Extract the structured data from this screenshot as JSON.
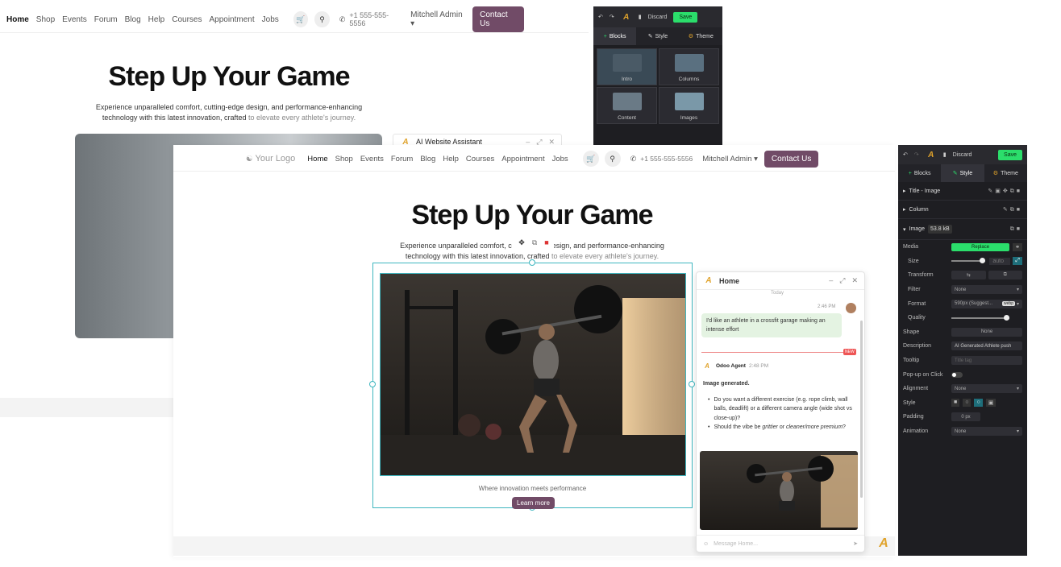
{
  "colors": {
    "brand": "#714b67",
    "save": "#2bde6b",
    "panel": "#1e1e22",
    "teal_selection": "#3fb6bf",
    "ai_accent": "#e0a32b"
  },
  "nav": {
    "logo": "Your Logo",
    "links": [
      "Home",
      "Shop",
      "Events",
      "Forum",
      "Blog",
      "Help",
      "Courses",
      "Appointment",
      "Jobs"
    ],
    "cart_icon": "cart-icon",
    "search_icon": "search-icon",
    "phone": "+1 555-555-5556",
    "user": "Mitchell Admin",
    "contact": "Contact Us"
  },
  "hero": {
    "title": "Step Up Your Game",
    "subtitle_start": "Experience unparalleled comfort, cutting-edge design, and performance-enhancing",
    "subtitle_line2": "technology with this latest innovation, crafted",
    "subtitle_highlight": "to elevate every athlete's journey.",
    "front_sub_a": "Experience unparalleled comfort,",
    "front_sub_a2": "c",
    "front_sub_b": "esign, and performance-enhancing",
    "caption": "Where innovation meets performance",
    "cta": "Learn more"
  },
  "back_assistant": {
    "title": "AI Website Assistant"
  },
  "back_editor": {
    "top": {
      "save": "Save",
      "discard": "Discard"
    },
    "tabs": [
      "Blocks",
      "Style",
      "Theme"
    ],
    "blocks": [
      "Intro",
      "Columns",
      "Content",
      "Images"
    ]
  },
  "editor": {
    "top": {
      "discard": "Discard",
      "save": "Save"
    },
    "tabs": [
      "Blocks",
      "Style",
      "Theme"
    ],
    "sections": {
      "title_image": "Title - Image",
      "column": "Column",
      "image": "Image",
      "image_size": "53.8 kB"
    },
    "options": {
      "media": "Media",
      "media_btn": "Replace",
      "size": "Size",
      "size_val": "auto",
      "transform": "Transform",
      "filter": "Filter",
      "filter_val": "None",
      "format": "Format",
      "format_val": "590px (Suggest...",
      "format_tag": "webp",
      "quality": "Quality",
      "shape": "Shape",
      "shape_val": "None",
      "description": "Description",
      "description_val": "AI Generated Athlete push",
      "tooltip": "Tooltip",
      "tooltip_ph": "Title tag",
      "popup": "Pop-up on Click",
      "alignment": "Alignment",
      "alignment_val": "None",
      "style": "Style",
      "padding": "Padding",
      "padding_val": "0 px",
      "animation": "Animation",
      "animation_val": "None"
    }
  },
  "chat": {
    "title": "Home",
    "day": "Today",
    "user_time": "2:46 PM",
    "user_msg": "I'd like an athlete in a crossfit garage making an intense effort",
    "new_badge": "NEW",
    "agent_name": "Odoo Agent",
    "agent_time": "2:48 PM",
    "generated": "Image generated.",
    "bullet1": "Do you want a different exercise (e.g. rope climb, wall balls, deadlift) or a different camera angle (wide shot vs close-up)?",
    "bullet2_a": "Should the vibe be",
    "bullet2_b": "grittier",
    "bullet2_c": "or",
    "bullet2_d": "cleaner/more premium",
    "bullet2_e": "?",
    "input_ph": "Message Home..."
  }
}
